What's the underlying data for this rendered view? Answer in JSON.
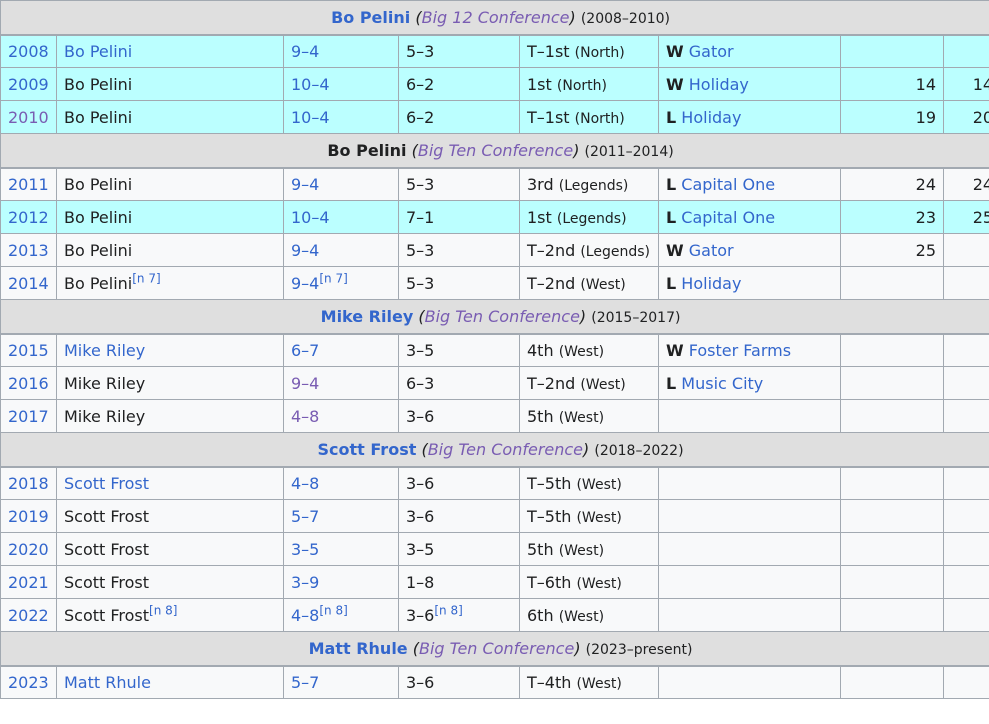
{
  "sections": [
    {
      "header": {
        "coach": "Bo Pelini",
        "open": "(",
        "conf": "Big 12 Conference",
        "close": ")",
        "years": "(2008–2010)",
        "coach_plain": false
      },
      "rows": [
        {
          "year": "2008",
          "coach": "Bo Pelini",
          "coach_link": true,
          "overall": "9–4",
          "conf": "5–3",
          "standing": "T–1st",
          "div": "(North)",
          "res": "W",
          "bowl": "Gator",
          "r1": "",
          "r2": "",
          "hl": true
        },
        {
          "year": "2009",
          "coach": "Bo Pelini",
          "overall": "10–4",
          "conf": "6–2",
          "standing": "1st",
          "div": "(North)",
          "res": "W",
          "bowl": "Holiday",
          "r1": "14",
          "r2": "14",
          "hl": true
        },
        {
          "year": "2010",
          "coach": "Bo Pelini",
          "overall": "10–4",
          "conf": "6–2",
          "standing": "T–1st",
          "div": "(North)",
          "res": "L",
          "bowl": "Holiday",
          "r1": "19",
          "r2": "20",
          "hl": true,
          "year_visited": true
        }
      ]
    },
    {
      "header": {
        "coach": "Bo Pelini",
        "open": "(",
        "conf": "Big Ten Conference",
        "close": ")",
        "years": "(2011–2014)",
        "coach_plain": true
      },
      "rows": [
        {
          "year": "2011",
          "coach": "Bo Pelini",
          "overall": "9–4",
          "conf": "5–3",
          "standing": "3rd",
          "div": "(Legends)",
          "res": "L",
          "bowl": "Capital One",
          "r1": "24",
          "r2": "24"
        },
        {
          "year": "2012",
          "coach": "Bo Pelini",
          "overall": "10–4",
          "conf": "7–1",
          "standing": "1st",
          "div": "(Legends)",
          "res": "L",
          "bowl": "Capital One",
          "r1": "23",
          "r2": "25",
          "hl": true
        },
        {
          "year": "2013",
          "coach": "Bo Pelini",
          "overall": "9–4",
          "conf": "5–3",
          "standing": "T–2nd",
          "div": "(Legends)",
          "res": "W",
          "bowl": "Gator",
          "r1": "25",
          "r2": ""
        },
        {
          "year": "2014",
          "coach": "Bo Pelini",
          "coach_note": "[n 7]",
          "overall": "9–4",
          "overall_note": "[n 7]",
          "conf": "5–3",
          "standing": "T–2nd",
          "div": "(West)",
          "res": "L",
          "bowl": "Holiday",
          "r1": "",
          "r2": ""
        }
      ]
    },
    {
      "header": {
        "coach": "Mike Riley",
        "open": "(",
        "conf": "Big Ten Conference",
        "close": ")",
        "years": "(2015–2017)",
        "coach_plain": false
      },
      "rows": [
        {
          "year": "2015",
          "coach": "Mike Riley",
          "coach_link": true,
          "overall": "6–7",
          "conf": "3–5",
          "standing": "4th",
          "div": "(West)",
          "res": "W",
          "bowl": "Foster Farms",
          "r1": "",
          "r2": ""
        },
        {
          "year": "2016",
          "coach": "Mike Riley",
          "overall": "9–4",
          "overall_visited": true,
          "conf": "6–3",
          "standing": "T–2nd",
          "div": "(West)",
          "res": "L",
          "bowl": "Music City",
          "r1": "",
          "r2": ""
        },
        {
          "year": "2017",
          "coach": "Mike Riley",
          "overall": "4–8",
          "overall_visited": true,
          "conf": "3–6",
          "standing": "5th",
          "div": "(West)",
          "res": "",
          "bowl": "",
          "r1": "",
          "r2": ""
        }
      ]
    },
    {
      "header": {
        "coach": "Scott Frost",
        "open": "(",
        "conf": "Big Ten Conference",
        "close": ")",
        "years": "(2018–2022)",
        "coach_plain": false
      },
      "rows": [
        {
          "year": "2018",
          "coach": "Scott Frost",
          "coach_link": true,
          "overall": "4–8",
          "conf": "3–6",
          "standing": "T–5th",
          "div": "(West)",
          "res": "",
          "bowl": "",
          "r1": "",
          "r2": ""
        },
        {
          "year": "2019",
          "coach": "Scott Frost",
          "overall": "5–7",
          "conf": "3–6",
          "standing": "T–5th",
          "div": "(West)",
          "res": "",
          "bowl": "",
          "r1": "",
          "r2": ""
        },
        {
          "year": "2020",
          "coach": "Scott Frost",
          "overall": "3–5",
          "conf": "3–5",
          "standing": "5th",
          "div": "(West)",
          "res": "",
          "bowl": "",
          "r1": "",
          "r2": ""
        },
        {
          "year": "2021",
          "coach": "Scott Frost",
          "overall": "3–9",
          "conf": "1–8",
          "standing": "T–6th",
          "div": "(West)",
          "res": "",
          "bowl": "",
          "r1": "",
          "r2": ""
        },
        {
          "year": "2022",
          "coach": "Scott Frost",
          "coach_note": "[n 8]",
          "overall": "4–8",
          "overall_note": "[n 8]",
          "conf": "3–6",
          "conf_note": "[n 8]",
          "standing": "6th",
          "div": "(West)",
          "res": "",
          "bowl": "",
          "r1": "",
          "r2": ""
        }
      ]
    },
    {
      "header": {
        "coach": "Matt Rhule",
        "open": "(",
        "conf": "Big Ten Conference",
        "close": ")",
        "years": "(2023–present)",
        "coach_plain": false
      },
      "rows": [
        {
          "year": "2023",
          "coach": "Matt Rhule",
          "coach_link": true,
          "overall": "5–7",
          "conf": "3–6",
          "standing": "T–4th",
          "div": "(West)",
          "res": "",
          "bowl": "",
          "r1": "",
          "r2": ""
        }
      ]
    }
  ]
}
